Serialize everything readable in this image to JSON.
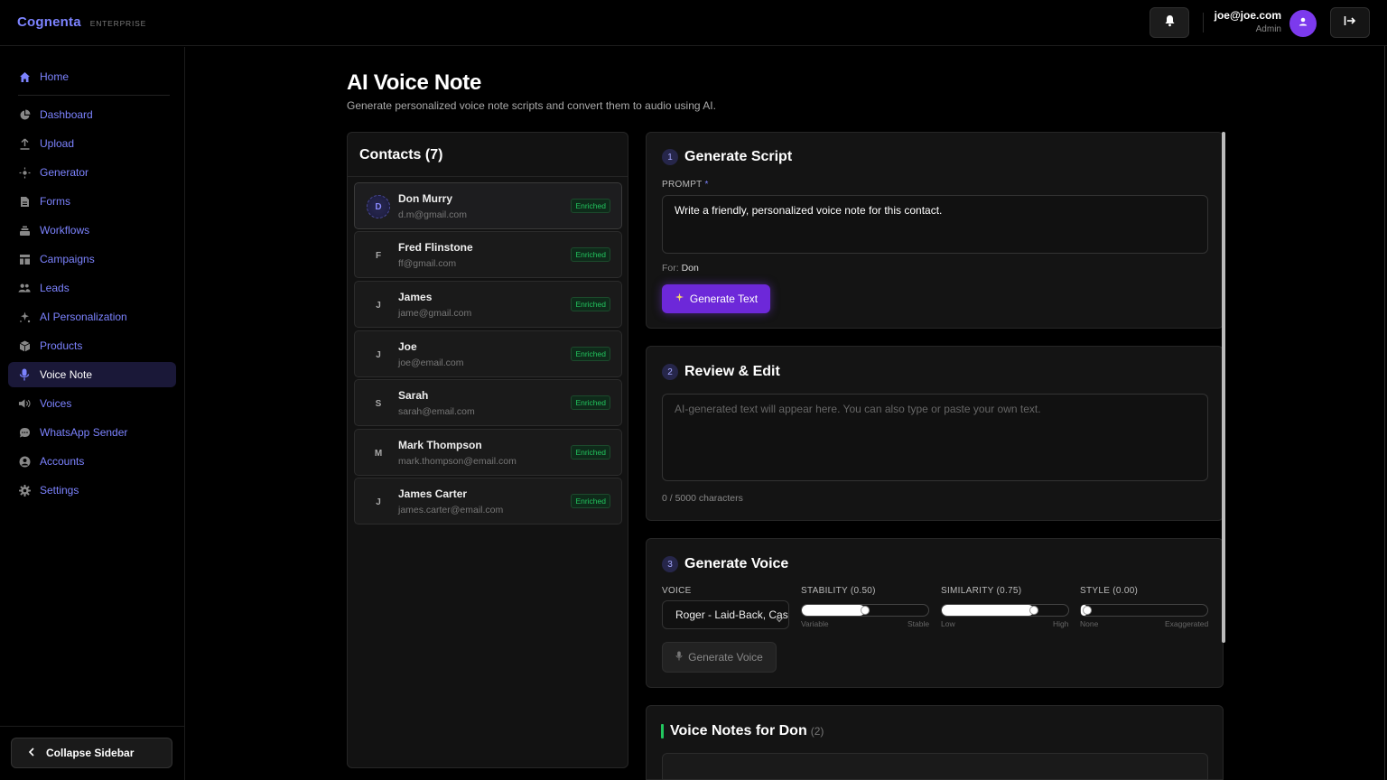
{
  "header": {
    "brand": "Cognenta",
    "brand_tag": "ENTERPRISE",
    "user_email": "joe@joe.com",
    "user_role": "Admin"
  },
  "sidebar": {
    "items": [
      {
        "label": "Home",
        "icon": "home-icon"
      },
      {
        "label": "Dashboard",
        "icon": "pie-chart-icon"
      },
      {
        "label": "Upload",
        "icon": "upload-icon"
      },
      {
        "label": "Generator",
        "icon": "sparkle-icon"
      },
      {
        "label": "Forms",
        "icon": "document-icon"
      },
      {
        "label": "Workflows",
        "icon": "layers-icon"
      },
      {
        "label": "Campaigns",
        "icon": "layout-icon"
      },
      {
        "label": "Leads",
        "icon": "users-icon"
      },
      {
        "label": "AI Personalization",
        "icon": "magic-icon"
      },
      {
        "label": "Products",
        "icon": "box-icon"
      },
      {
        "label": "Voice Note",
        "icon": "microphone-icon",
        "active": true
      },
      {
        "label": "Voices",
        "icon": "speaker-icon"
      },
      {
        "label": "WhatsApp Sender",
        "icon": "chat-icon"
      },
      {
        "label": "Accounts",
        "icon": "user-circle-icon"
      },
      {
        "label": "Settings",
        "icon": "gear-icon"
      }
    ],
    "collapse_label": "Collapse Sidebar"
  },
  "page": {
    "title": "AI Voice Note",
    "subtitle": "Generate personalized voice note scripts and convert them to audio using AI."
  },
  "contacts": {
    "title": "Contacts (7)",
    "items": [
      {
        "initial": "D",
        "name": "Don Murry",
        "email": "d.m@gmail.com",
        "badge": "Enriched",
        "selected": true
      },
      {
        "initial": "F",
        "name": "Fred Flinstone",
        "email": "ff@gmail.com",
        "badge": "Enriched"
      },
      {
        "initial": "J",
        "name": "James",
        "email": "jame@gmail.com",
        "badge": "Enriched"
      },
      {
        "initial": "J",
        "name": "Joe",
        "email": "joe@email.com",
        "badge": "Enriched"
      },
      {
        "initial": "S",
        "name": "Sarah",
        "email": "sarah@email.com",
        "badge": "Enriched"
      },
      {
        "initial": "M",
        "name": "Mark Thompson",
        "email": "mark.thompson@email.com",
        "badge": "Enriched"
      },
      {
        "initial": "J",
        "name": "James Carter",
        "email": "james.carter@email.com",
        "badge": "Enriched"
      }
    ]
  },
  "step1": {
    "num": "1",
    "title": "Generate Script",
    "prompt_label": "PROMPT",
    "required_mark": "*",
    "prompt_value": "Write a friendly, personalized voice note for this contact.",
    "for_label": "For:",
    "for_value": "Don",
    "button": "Generate Text"
  },
  "step2": {
    "num": "2",
    "title": "Review & Edit",
    "placeholder": "AI-generated text will appear here. You can also type or paste your own text.",
    "char_count": "0 / 5000 characters"
  },
  "step3": {
    "num": "3",
    "title": "Generate Voice",
    "voice_label": "VOICE",
    "voice_value": "Roger - Laid-Back, Casual",
    "stability_label": "STABILITY (0.50)",
    "stability_value": 0.5,
    "stability_min": "Variable",
    "stability_max": "Stable",
    "similarity_label": "SIMILARITY (0.75)",
    "similarity_value": 0.75,
    "similarity_min": "Low",
    "similarity_max": "High",
    "style_label": "STYLE (0.00)",
    "style_value": 0.0,
    "style_min": "None",
    "style_max": "Exaggerated",
    "button": "Generate Voice"
  },
  "voice_notes": {
    "title": "Voice Notes for Don",
    "count": "(2)"
  },
  "colors": {
    "accent": "#7c83ff",
    "primary_button": "#6d28d9",
    "enriched": "#22c55e"
  }
}
